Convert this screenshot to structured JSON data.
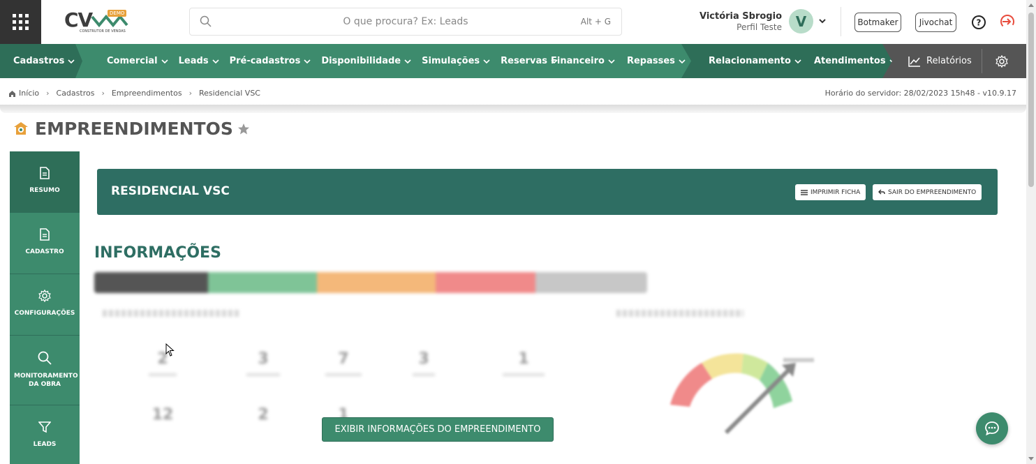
{
  "topbar": {
    "logo_text": "CV",
    "logo_badge": "DEMO",
    "logo_sub": "CONSTRUTOR DE VENDAS",
    "search_placeholder": "O que procura? Ex: Leads",
    "search_shortcut": "Alt + G",
    "user_name": "Victória Sbrogio",
    "user_profile": "Perfil Teste",
    "avatar_letter": "V",
    "botmaker": "Botmaker",
    "jivochat": "Jivochat"
  },
  "nav": {
    "cadastros": "Cadastros",
    "comercial": "Comercial",
    "leads": "Leads",
    "pre_cadastros": "Pré-cadastros",
    "disponibilidade": "Disponibilidade",
    "simulacoes": "Simulações",
    "reservas": "Reservas",
    "financeiro": "Financeiro",
    "repasses": "Repasses",
    "relacionamento": "Relacionamento",
    "atendimentos": "Atendimentos",
    "relatorios": "Relatórios"
  },
  "breadcrumb": {
    "items": [
      "Início",
      "Cadastros",
      "Empreendimentos",
      "Residencial VSC"
    ],
    "server_time": "Horário do servidor: 28/02/2023 15h48 - v10.9.17"
  },
  "page": {
    "title": "EMPREENDIMENTOS"
  },
  "sidenav": {
    "items": [
      "RESUMO",
      "CADASTRO",
      "CONFIGURAÇÕES",
      "MONITORAMENTO DA OBRA",
      "LEADS"
    ]
  },
  "header_card": {
    "title": "RESIDENCIAL VSC",
    "print_label": "IMPRIMIR FICHA",
    "exit_label": "SAIR DO EMPREENDIMENTO"
  },
  "info": {
    "title": "INFORMAÇÕES",
    "stats_row1": [
      "2",
      "3",
      "7",
      "3",
      "1"
    ],
    "stats_row2": [
      "12",
      "2",
      "1"
    ],
    "show_button": "EXIBIR INFORMAÇÕES DO EMPREENDIMENTO"
  },
  "colors": {
    "brand_green": "#3d8b6d",
    "dark_green": "#2e6e58",
    "header_teal": "#2e6e63",
    "logout_red": "#e84c3d",
    "star_gray": "#999999"
  }
}
